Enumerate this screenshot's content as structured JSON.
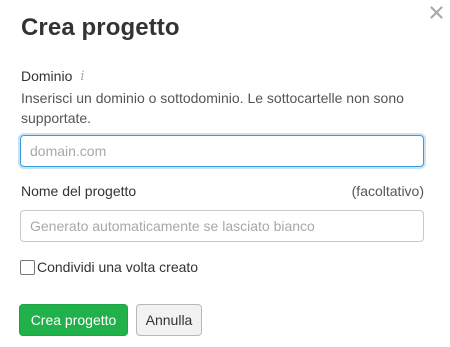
{
  "dialog": {
    "title": "Crea progetto",
    "close_icon": "close-icon"
  },
  "domain": {
    "label": "Dominio",
    "info_icon": "info-icon",
    "info_glyph": "i",
    "help": "Inserisci un dominio o sottodominio. Le sottocartelle non sono supportate.",
    "placeholder": "domain.com",
    "value": ""
  },
  "project_name": {
    "label": "Nome del progetto",
    "optional": "(facoltativo)",
    "placeholder": "Generato automaticamente se lasciato bianco",
    "value": ""
  },
  "share": {
    "label": "Condividi una volta creato",
    "checked": false
  },
  "actions": {
    "create_label": "Crea progetto",
    "cancel_label": "Annulla"
  },
  "colors": {
    "primary": "#21b14a",
    "focus": "#3b9cdb"
  }
}
